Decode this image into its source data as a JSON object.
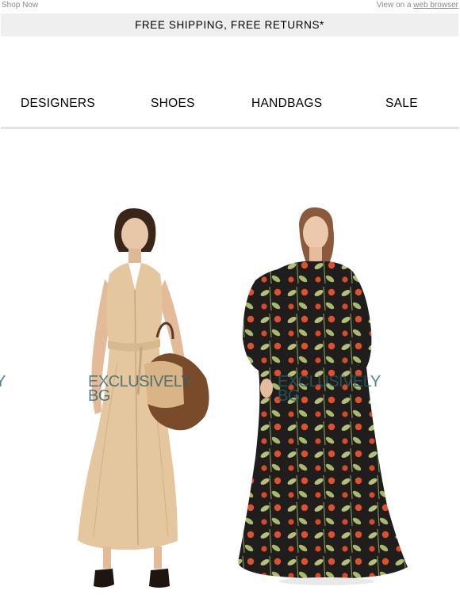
{
  "preheader": {
    "left": "Shop Now",
    "right_prefix": "View on a ",
    "right_link": "web browser"
  },
  "shipping_banner": "FREE SHIPPING, FREE RETURNS*",
  "nav": {
    "items": [
      "DESIGNERS",
      "SHOES",
      "HANDBAGS",
      "SALE"
    ]
  },
  "hero": {
    "overlay_line1": "EXCLUSIVELY",
    "overlay_line2": "BG",
    "overlay_partial": "Y"
  },
  "colors": {
    "banner_bg": "#efefef",
    "overlay": "#285f69",
    "dress_left": "#e4c79e",
    "dress_right": "#1f1e1c"
  }
}
